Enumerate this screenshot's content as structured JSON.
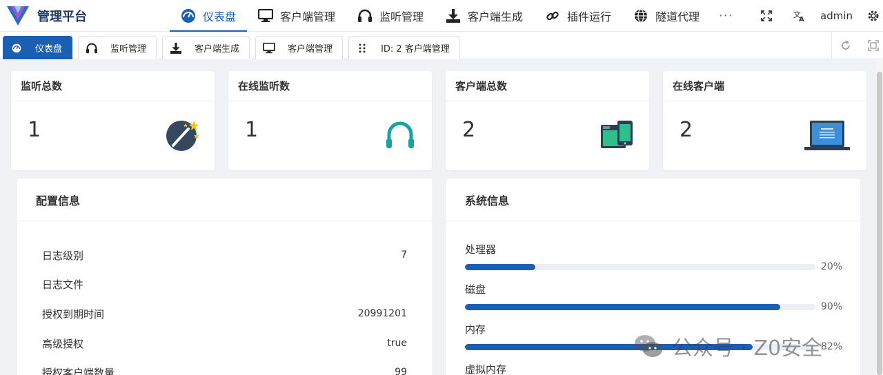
{
  "app": {
    "title": "管理平台",
    "user": "admin"
  },
  "nav": {
    "items": [
      {
        "label": "仪表盘",
        "icon": "dashboard-icon",
        "active": true
      },
      {
        "label": "客户端管理",
        "icon": "monitor-icon",
        "active": false
      },
      {
        "label": "监听管理",
        "icon": "headphones-icon",
        "active": false
      },
      {
        "label": "客户端生成",
        "icon": "download-icon",
        "active": false
      },
      {
        "label": "插件运行",
        "icon": "link-icon",
        "active": false
      },
      {
        "label": "隧道代理",
        "icon": "globe-icon",
        "active": false
      }
    ],
    "more": "···"
  },
  "tabs": [
    {
      "label": "仪表盘",
      "icon": "dashboard-icon",
      "active": true
    },
    {
      "label": "监听管理",
      "icon": "headphones-icon",
      "active": false
    },
    {
      "label": "客户端生成",
      "icon": "download-icon",
      "active": false
    },
    {
      "label": "客户端管理",
      "icon": "monitor-icon",
      "active": false
    },
    {
      "label": "ID: 2 客户端管理",
      "icon": "drag-handle-icon",
      "active": false
    }
  ],
  "stats": [
    {
      "title": "监听总数",
      "value": "1",
      "icon": "wand-icon"
    },
    {
      "title": "在线监听数",
      "value": "1",
      "icon": "headphones-icon"
    },
    {
      "title": "客户端总数",
      "value": "2",
      "icon": "devices-icon"
    },
    {
      "title": "在线客户端",
      "value": "2",
      "icon": "laptop-icon"
    }
  ],
  "config": {
    "title": "配置信息",
    "rows": [
      {
        "label": "日志级别",
        "value": "7"
      },
      {
        "label": "日志文件",
        "value": ""
      },
      {
        "label": "授权到期时间",
        "value": "20991201"
      },
      {
        "label": "高级授权",
        "value": "true"
      },
      {
        "label": "授权客户端数量",
        "value": "99"
      }
    ]
  },
  "system": {
    "title": "系统信息",
    "items": [
      {
        "label": "处理器",
        "percent": 20,
        "text": "20%"
      },
      {
        "label": "磁盘",
        "percent": 90,
        "text": "90%"
      },
      {
        "label": "内存",
        "percent": 82,
        "text": "82%"
      },
      {
        "label": "虚拟内存",
        "percent": 0,
        "text": ""
      }
    ]
  },
  "colors": {
    "accent": "#1a5fb4",
    "nav_text": "#303133",
    "track": "#ebeef5"
  },
  "watermark": {
    "text": "公众号 · Z0安全"
  }
}
